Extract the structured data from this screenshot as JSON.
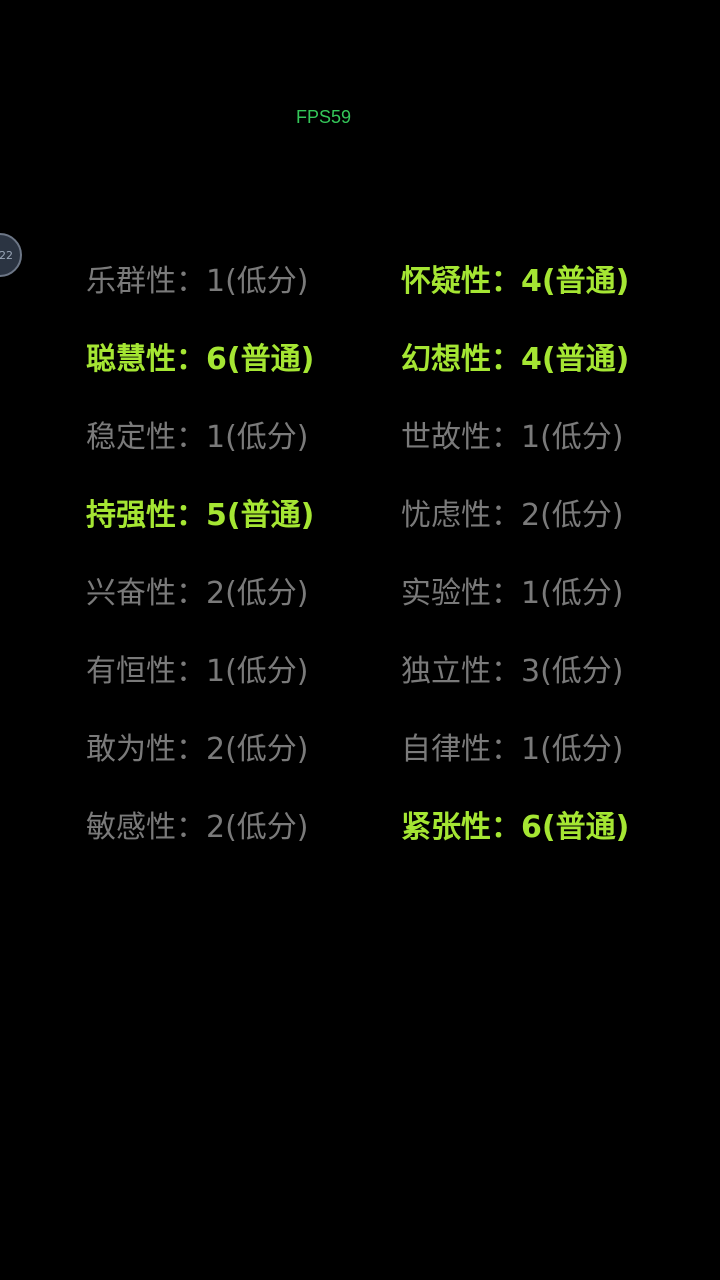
{
  "fps_label": "FPS59",
  "float_button_text": "22",
  "colors": {
    "background": "#000000",
    "normal": "#7a7a7a",
    "highlight": "#a5e633",
    "fps": "#34c759"
  },
  "traits": [
    {
      "name": "乐群性",
      "sep": "：",
      "value": "1(低分)",
      "highlight": false
    },
    {
      "name": "怀疑性",
      "sep": "：",
      "value": "4(普通)",
      "highlight": true
    },
    {
      "name": "聪慧性",
      "sep": "：",
      "value": "6(普通)",
      "highlight": true
    },
    {
      "name": "幻想性",
      "sep": "：",
      "value": "4(普通)",
      "highlight": true
    },
    {
      "name": "稳定性",
      "sep": "：",
      "value": "1(低分)",
      "highlight": false
    },
    {
      "name": "世故性",
      "sep": "：",
      "value": "1(低分)",
      "highlight": false
    },
    {
      "name": "持强性",
      "sep": "：",
      "value": "5(普通)",
      "highlight": true
    },
    {
      "name": "忧虑性",
      "sep": "：",
      "value": "2(低分)",
      "highlight": false
    },
    {
      "name": "兴奋性",
      "sep": "：",
      "value": "2(低分)",
      "highlight": false
    },
    {
      "name": "实验性",
      "sep": "：",
      "value": "1(低分)",
      "highlight": false
    },
    {
      "name": "有恒性",
      "sep": "：",
      "value": "1(低分)",
      "highlight": false
    },
    {
      "name": "独立性",
      "sep": "：",
      "value": "3(低分)",
      "highlight": false
    },
    {
      "name": "敢为性",
      "sep": "：",
      "value": "2(低分)",
      "highlight": false
    },
    {
      "name": "自律性",
      "sep": "：",
      "value": "1(低分)",
      "highlight": false
    },
    {
      "name": "敏感性",
      "sep": "：",
      "value": "2(低分)",
      "highlight": false
    },
    {
      "name": "紧张性",
      "sep": "：",
      "value": "6(普通)",
      "highlight": true
    }
  ]
}
